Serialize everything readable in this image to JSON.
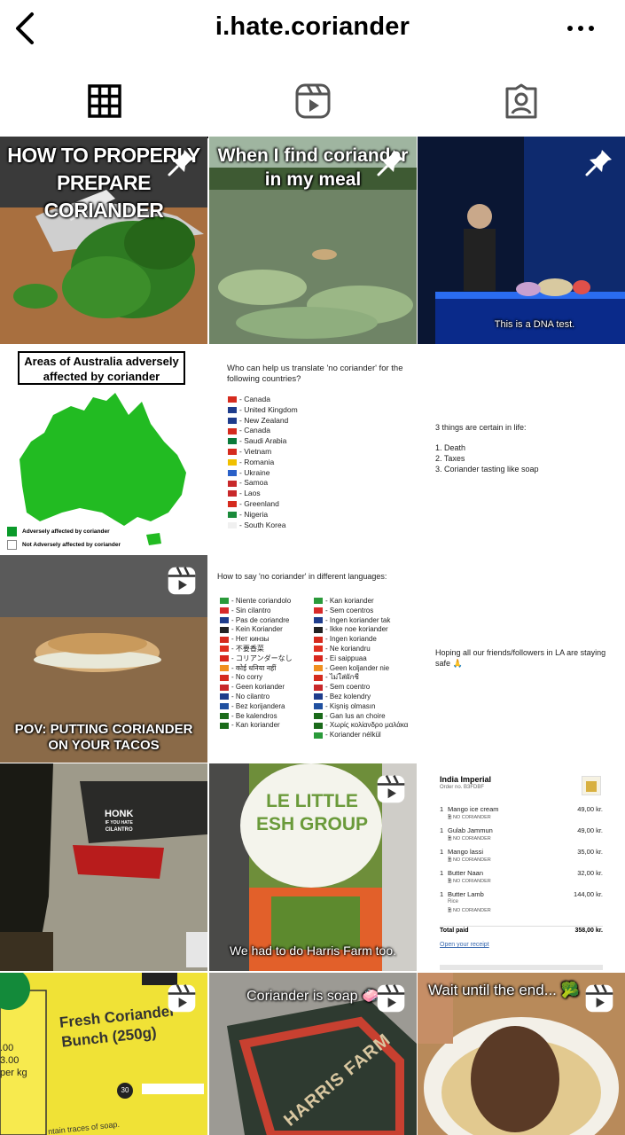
{
  "header": {
    "title": "i.hate.coriander"
  },
  "tiles": {
    "t1": {
      "caption": "HOW TO PROPERLY\nPREPARE CORIANDER"
    },
    "t2": {
      "caption": "When I find coriander\nin my meal"
    },
    "t3": {
      "caption": "This is a DNA test."
    },
    "t4": {
      "title_line1": "Areas of Australia adversely",
      "title_line2": "affected by coriander",
      "legend_a": "Adversely affected by coriander",
      "legend_b": "Not Adversely affected by coriander",
      "color_a": "#22bb22"
    },
    "t5": {
      "title": "Who can help us translate 'no coriander' for the following countries?",
      "countries": [
        "Canada",
        "United Kingdom",
        "New Zealand",
        "Canada",
        "Saudi Arabia",
        "Vietnam",
        "Romania",
        "Ukraine",
        "Samoa",
        "Laos",
        "Greenland",
        "Nigeria",
        "South Korea"
      ]
    },
    "t6": {
      "line1": "3 things are certain in life:",
      "items": [
        "1. Death",
        "2. Taxes",
        "3. Coriander tasting like soap"
      ]
    },
    "t7": {
      "caption": "POV: PUTTING CORIANDER\nON YOUR TACOS"
    },
    "t8": {
      "title": "How to say 'no coriander' in different languages:",
      "col1": [
        "- Niente coriandolo",
        "- Sin cilantro",
        "- Pas de coriandre",
        "- Kein Koriander",
        "- Нет кинзы",
        "- 不要香菜",
        "- コリアンダーなし",
        "- कोई धनिया नहीं",
        "- No corry",
        "- Geen koriander",
        "- No cilantro",
        "- Bez korijandera",
        "- Be kalendros",
        "- Kan koriander"
      ],
      "col2": [
        "- Kan koriander",
        "- Sem coentros",
        "- Ingen koriander tak",
        "- Ikke noe koriander",
        "- Ingen koriande",
        "- Ne koriandru",
        "- Ei saippuaa",
        "- Geen koljander nie",
        "- ไม่ใส่ผักชี",
        "- Sem coentro",
        "- Bez kolendry",
        "- Kişniş olmasın",
        "- Gan lus an choire",
        "- Χωρίς κολίανδρο μαλάκα",
        "- Koriander nélkül"
      ]
    },
    "t9": {
      "text": "Hoping all our friends/followers in LA are staying safe 🙏"
    },
    "t10": {
      "sticker_line1": "HONK",
      "sticker_line2": "IF YOU HATE",
      "sticker_line3": "CILANTRO"
    },
    "t11": {
      "caption": "We had to do Harris Farm too.",
      "jar_text": "LE LITTLE\nESH GROUP"
    },
    "t12": {
      "restaurant": "India Imperial",
      "order": "Order no. B3FDBF",
      "items": [
        {
          "qty": "1",
          "name": "Mango ice cream",
          "price": "49,00 kr.",
          "note": "NO CORIANDER"
        },
        {
          "qty": "1",
          "name": "Gulab Jammun",
          "price": "49,00 kr.",
          "note": "NO CORIANDER"
        },
        {
          "qty": "1",
          "name": "Mango lassi",
          "price": "35,00 kr.",
          "note": "NO CORIANDER"
        },
        {
          "qty": "1",
          "name": "Butter Naan",
          "price": "32,00 kr.",
          "note": "NO CORIANDER"
        },
        {
          "qty": "1",
          "name": "Butter Lamb",
          "price": "144,00 kr.",
          "note": "NO CORIANDER"
        }
      ],
      "sub": "Rice",
      "total_label": "Total paid",
      "total": "358,00 kr.",
      "link": "Open your receipt"
    },
    "t13": {
      "sign_title": "Fresh Coriander\nBunch (250g)",
      "price1": ".00",
      "price2": "3.00",
      "price3": "per kg",
      "badge": "30",
      "small": "ntain traces of soap."
    },
    "t14": {
      "caption": "Coriander is soap 🧼",
      "mat": "HARRIS FARM"
    },
    "t15": {
      "caption": "Wait until the end... 🥦"
    }
  }
}
